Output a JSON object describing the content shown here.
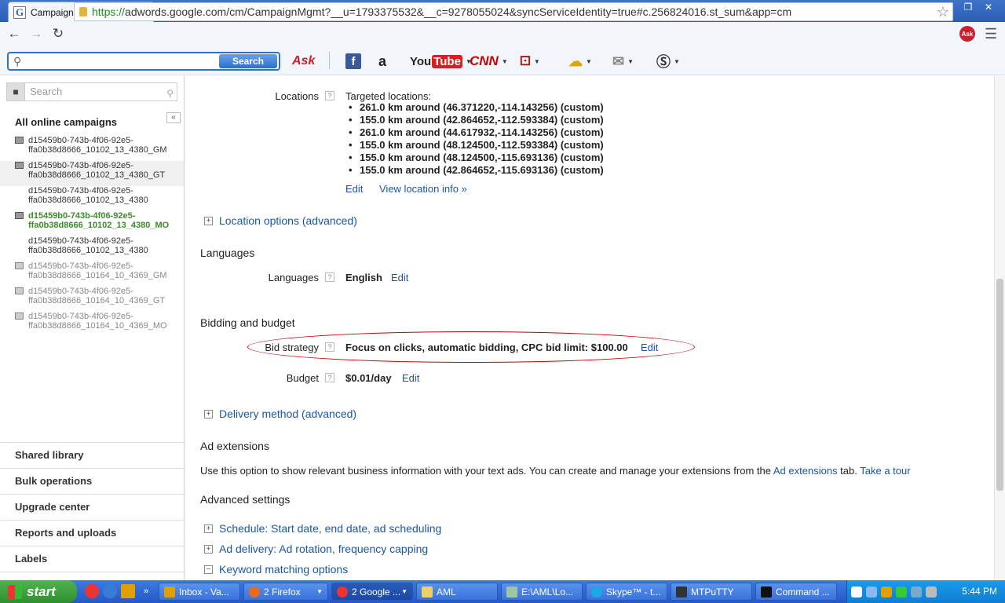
{
  "browser": {
    "tab_title": "Campaign Management",
    "tab_favicon": "G",
    "tab_close": "×",
    "url_scheme": "https://",
    "url_rest": "adwords.google.com/cm/CampaignMgmt?__u=1793375532&__c=9278055024&syncServiceIdentity=true#c.256824016.st_sum&app=cm",
    "window_controls": [
      "—",
      "❐",
      "✕"
    ]
  },
  "ask_toolbar": {
    "search_placeholder": "",
    "search_button": "Search",
    "ask_label": "Ask",
    "facebook_label": "f",
    "amazon_label": "a",
    "youtube_label_you": "You",
    "youtube_label_tube": "Tube",
    "cnn_label": "CNN",
    "icons": [
      "facebook-icon",
      "amazon-icon",
      "youtube-icon",
      "cnn-icon",
      "games-icon",
      "weather-icon",
      "mail-icon",
      "dictionary-icon"
    ]
  },
  "sidebar": {
    "search_placeholder": "Search",
    "all_campaigns": "All online campaigns",
    "campaigns": [
      {
        "line1": "d15459b0-743b-4f06-92e5-",
        "line2": "ffa0b38d8666_10102_13_4380_GM"
      },
      {
        "line1": "d15459b0-743b-4f06-92e5-",
        "line2": "ffa0b38d8666_10102_13_4380_GT"
      },
      {
        "line1": "d15459b0-743b-4f06-92e5-",
        "line2": "ffa0b38d8666_10102_13_4380"
      },
      {
        "line1": "d15459b0-743b-4f06-92e5-",
        "line2": "ffa0b38d8666_10102_13_4380_MO"
      },
      {
        "line1": "d15459b0-743b-4f06-92e5-",
        "line2": "ffa0b38d8666_10102_13_4380"
      },
      {
        "line1": "d15459b0-743b-4f06-92e5-",
        "line2": "ffa0b38d8666_10164_10_4369_GM"
      },
      {
        "line1": "d15459b0-743b-4f06-92e5-",
        "line2": "ffa0b38d8666_10164_10_4369_GT"
      },
      {
        "line1": "d15459b0-743b-4f06-92e5-",
        "line2": "ffa0b38d8666_10164_10_4369_MO"
      }
    ],
    "bottom_links": [
      "Shared library",
      "Bulk operations",
      "Upgrade center",
      "Reports and uploads",
      "Labels"
    ]
  },
  "main": {
    "help_glyph": "?",
    "locations_label": "Locations",
    "targeted_locations": "Targeted locations:",
    "locations": [
      "261.0 km around (46.371220,-114.143256) (custom)",
      "155.0 km around (42.864652,-112.593384) (custom)",
      "261.0 km around (44.617932,-114.143256) (custom)",
      "155.0 km around (48.124500,-112.593384) (custom)",
      "155.0 km around (48.124500,-115.693136) (custom)",
      "155.0 km around (42.864652,-115.693136) (custom)"
    ],
    "edit": "Edit",
    "view_location_info": "View location info »",
    "location_options": "Location options (advanced)",
    "languages_heading": "Languages",
    "languages_label": "Languages",
    "languages_value": "English",
    "bidding_heading": "Bidding and budget",
    "bid_strategy_label": "Bid strategy",
    "bid_strategy_value": "Focus on clicks, automatic bidding, CPC bid limit: $100.00",
    "budget_label": "Budget",
    "budget_value": "$0.01/day",
    "delivery_method": "Delivery method (advanced)",
    "ad_extensions_heading": "Ad extensions",
    "ad_ext_text": "Use this option to show relevant business information with your text ads. You can create and manage your extensions from the",
    "ad_ext_link": "Ad extensions",
    "ad_ext_tab": "tab.",
    "take_a_tour": "Take a tour",
    "advanced_heading": "Advanced settings",
    "schedule": "Schedule: Start date, end date, ad scheduling",
    "ad_delivery": "Ad delivery: Ad rotation, frequency capping",
    "keyword_matching": "Keyword matching options",
    "expand_glyph": "+",
    "collapse_glyph": "−"
  },
  "taskbar": {
    "start": "start",
    "tasks": [
      "Inbox - Va...",
      "2 Firefox",
      "2 Google ...",
      "AML",
      "E:\\AML\\Lo...",
      "Skype™ - t...",
      "MTPuTTY",
      "Command ..."
    ],
    "clock": "5:44 PM"
  }
}
